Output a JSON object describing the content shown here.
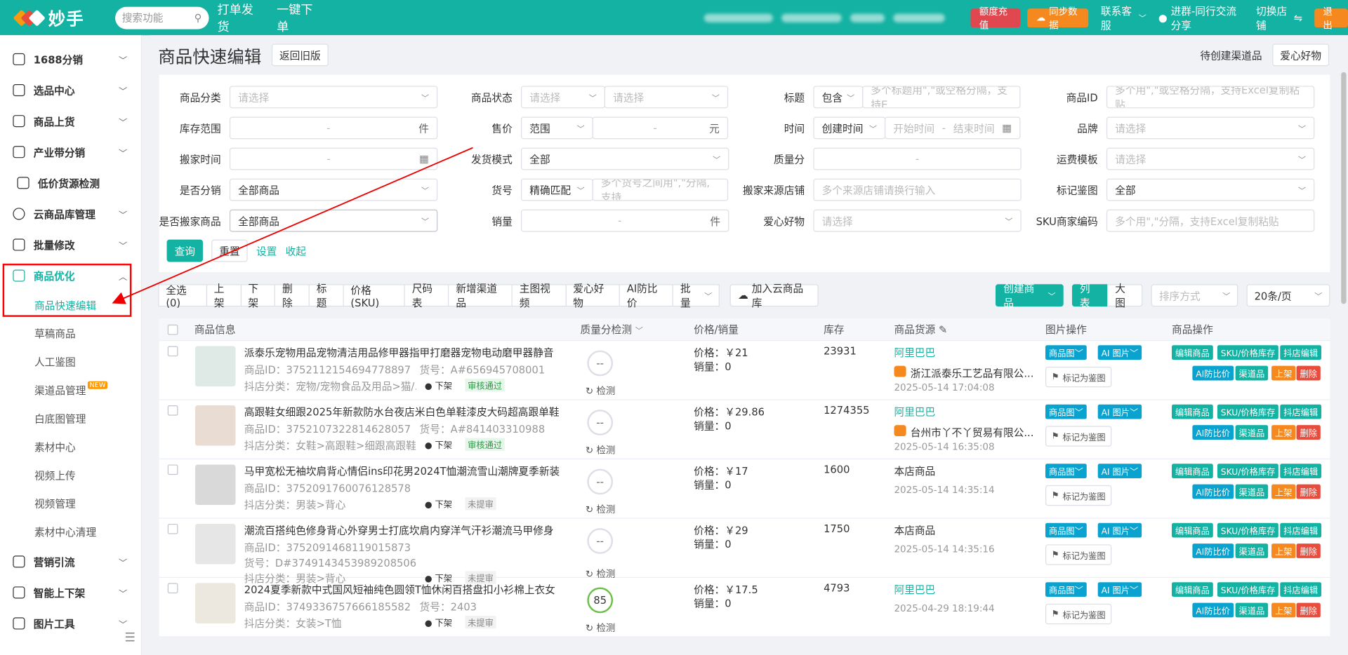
{
  "app": {
    "title": "妙手",
    "search_placeholder": "搜索功能",
    "nav": [
      "打单发货",
      "一键下单"
    ],
    "recharge": "额度充值",
    "sync": "同步数据",
    "service": "联系客服",
    "group": "进群-同行交流分享",
    "switch_store": "切换店铺",
    "logout": "退出"
  },
  "sidebar": {
    "items": [
      {
        "label": "1688分销"
      },
      {
        "label": "选品中心"
      },
      {
        "label": "商品上货"
      },
      {
        "label": "产业带分销"
      },
      {
        "label": "低价货源检测"
      },
      {
        "label": "云商品库管理"
      },
      {
        "label": "批量修改"
      },
      {
        "label": "商品优化"
      }
    ],
    "subitems": [
      {
        "label": "商品快速编辑"
      },
      {
        "label": "草稿商品"
      },
      {
        "label": "人工鉴图"
      },
      {
        "label": "渠道品管理",
        "badge": "NEW"
      },
      {
        "label": "白底图管理"
      },
      {
        "label": "素材中心"
      },
      {
        "label": "视频上传"
      },
      {
        "label": "视频管理"
      },
      {
        "label": "素材中心清理"
      }
    ],
    "bottom": [
      {
        "label": "营销引流"
      },
      {
        "label": "智能上下架"
      },
      {
        "label": "图片工具"
      }
    ]
  },
  "page": {
    "title": "商品快速编辑",
    "back": "返回旧版",
    "pending": "待创建渠道品",
    "love": "爱心好物"
  },
  "filters": {
    "category": {
      "label": "商品分类",
      "ph": "请选择"
    },
    "status": {
      "label": "商品状态",
      "ph1": "请选择",
      "ph2": "请选择"
    },
    "title": {
      "label": "标题",
      "mode": "包含",
      "ph": "多个标题用\",\"或空格分隔，支持E"
    },
    "pid": {
      "label": "商品ID",
      "ph": "多个用\",\"或空格分隔，支持Excel复制粘贴"
    },
    "stock": {
      "label": "库存范围",
      "sep": "-",
      "unit": "件"
    },
    "price": {
      "label": "售价",
      "mode": "范围",
      "sep": "-",
      "unit": "元"
    },
    "time": {
      "label": "时间",
      "mode": "创建时间",
      "start": "开始时间",
      "sep": "-",
      "end": "结束时间"
    },
    "brand": {
      "label": "品牌",
      "ph": "请选择"
    },
    "move_time": {
      "label": "搬家时间",
      "sep": "-"
    },
    "ship": {
      "label": "发货模式",
      "value": "全部"
    },
    "quality": {
      "label": "质量分",
      "sep": "-"
    },
    "freight": {
      "label": "运费模板",
      "ph": "请选择"
    },
    "distrib": {
      "label": "是否分销",
      "value": "全部商品"
    },
    "sku_no": {
      "label": "货号",
      "mode": "精确匹配",
      "ph": "多个货号之间用\",\"分隔,支持"
    },
    "src_store": {
      "label": "搬家来源店铺",
      "ph": "多个来源店铺请换行输入"
    },
    "mark": {
      "label": "标记鉴图",
      "value": "全部"
    },
    "moved": {
      "label": "是否搬家商品",
      "value": "全部商品"
    },
    "sales": {
      "label": "销量",
      "sep": "-",
      "unit": "件"
    },
    "love": {
      "label": "爱心好物",
      "ph": "请选择"
    },
    "sku_code": {
      "label": "SKU商家编码",
      "ph": "多个用\",\"分隔，支持Excel复制粘贴"
    },
    "query": "查询",
    "reset": "重置",
    "settings": "设置",
    "collapse": "收起"
  },
  "toolbar": {
    "buttons": [
      "全选(0)",
      "上架",
      "下架",
      "删除",
      "标题",
      "价格(SKU)",
      "尺码表",
      "新增渠道品",
      "主图视频",
      "爱心好物",
      "AI防比价",
      "批量"
    ],
    "cloud": "加入云商品库",
    "create": "创建商品",
    "list": "列表",
    "grid": "大图",
    "sort": "排序方式",
    "page_size": "20条/页"
  },
  "table": {
    "headers": [
      "商品信息",
      "质量分检测",
      "价格/销量",
      "库存",
      "商品货源",
      "图片操作",
      "商品操作"
    ],
    "rows": [
      {
        "title": "派泰乐宠物用品宠物清洁用品修甲器指甲打磨器宠物电动磨甲器静音",
        "id": "商品ID：3752112154694778897",
        "sku": "货号：A#656945708001",
        "cat": "抖店分类：宠物/宠物食品及用品>猫/...",
        "state": "下架",
        "audit": "审核通过",
        "audit_ok": true,
        "score": "--",
        "check": "检测",
        "price": "价格：￥21",
        "sales": "销量：0",
        "stock": "23931",
        "source": "阿里巴巴",
        "supplier": "浙江派泰乐工艺品有限公...",
        "time": "2025-05-14 17:04:08"
      },
      {
        "title": "高跟鞋女细跟2025年新款防水台夜店米白色单鞋漆皮大码超高跟单鞋",
        "id": "商品ID：3752107322814628057",
        "sku": "货号：A#841403310988",
        "cat": "抖店分类：女鞋>高跟鞋>细跟高跟鞋",
        "state": "下架",
        "audit": "审核通过",
        "audit_ok": true,
        "score": "--",
        "check": "检测",
        "price": "价格：￥29.86",
        "sales": "销量：0",
        "stock": "1274355",
        "source": "阿里巴巴",
        "supplier": "台州市丫不丫贸易有限公...",
        "time": "2025-05-14 16:35:08"
      },
      {
        "title": "马甲宽松无袖坎肩背心情侣ins印花男2024T恤潮流雪山潮牌夏季新装",
        "id": "商品ID：3752091760076128578",
        "sku": "",
        "cat": "抖店分类：男装>背心",
        "state": "下架",
        "audit": "未提审",
        "audit_ok": false,
        "score": "--",
        "check": "检测",
        "price": "价格：￥17",
        "sales": "销量：0",
        "stock": "1600",
        "source": "本店商品",
        "supplier": "",
        "time": "2025-05-14 14:35:14"
      },
      {
        "title": "潮流百搭纯色修身背心外穿男士打底坎肩内穿洋气汗衫潮流马甲修身",
        "id": "商品ID：3752091468119015873",
        "sku": "货号：D#3749143453989208506",
        "cat": "抖店分类：男装>背心",
        "state": "下架",
        "audit": "未提审",
        "audit_ok": false,
        "score": "--",
        "check": "检测",
        "price": "价格：￥29",
        "sales": "销量：0",
        "stock": "1750",
        "source": "本店商品",
        "supplier": "",
        "time": "2025-05-14 14:35:16"
      },
      {
        "title": "2024夏季新款中式国风短袖纯色圆领T恤休闲百搭盘扣小衫棉上衣女",
        "id": "商品ID：3749336757666185582",
        "sku": "货号：2403",
        "cat": "抖店分类：女装>T恤",
        "state": "下架",
        "audit": "未提审",
        "audit_ok": false,
        "score": "85",
        "check": "检测",
        "price": "价格：￥17.5",
        "sales": "销量：0",
        "stock": "4793",
        "source": "阿里巴巴",
        "supplier": "",
        "time": "2025-04-29 18:19:44"
      }
    ],
    "img_ops": {
      "main_img": "商品图",
      "ai_img": "AI 图片",
      "mark": "标记为鉴图"
    },
    "prod_ops": {
      "edit": "编辑商品",
      "sku": "SKU/价格库存",
      "douyin": "抖店编辑",
      "ai": "AI防比价",
      "channel": "渠道品",
      "up": "上架",
      "del": "删除"
    }
  },
  "colors": {
    "brand": "#14b2a2",
    "blue": "#0aa2ce",
    "orange": "#f5891f",
    "red": "#e74c3c"
  }
}
